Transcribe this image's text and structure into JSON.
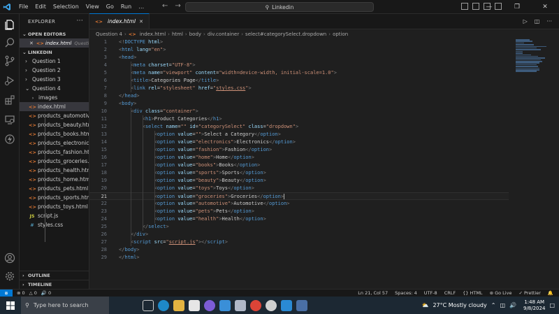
{
  "titlebar": {
    "menu": [
      "File",
      "Edit",
      "Selection",
      "View",
      "Go",
      "Run",
      "…"
    ],
    "search_text": "Linkedin"
  },
  "sidebar": {
    "title": "EXPLORER",
    "open_editors_label": "OPEN EDITORS",
    "open_editor": {
      "name": "index.html",
      "folder": "Questi..."
    },
    "workspace_label": "LINKEDIN",
    "folders": [
      "Question 1",
      "Question 2",
      "Question 3",
      "Question 4"
    ],
    "q4_items": [
      {
        "name": "images",
        "type": "folder"
      },
      {
        "name": "index.html",
        "type": "html"
      },
      {
        "name": "products_automotiv...",
        "type": "html"
      },
      {
        "name": "products_beauty.html",
        "type": "html"
      },
      {
        "name": "products_books.html",
        "type": "html"
      },
      {
        "name": "products_electronics....",
        "type": "html"
      },
      {
        "name": "products_fashion.html",
        "type": "html"
      },
      {
        "name": "products_groceries....",
        "type": "html"
      },
      {
        "name": "products_health.html",
        "type": "html"
      },
      {
        "name": "products_home.html",
        "type": "html"
      },
      {
        "name": "products_pets.html",
        "type": "html"
      },
      {
        "name": "products_sports.html",
        "type": "html"
      },
      {
        "name": "products_toys.html",
        "type": "html"
      },
      {
        "name": "script.js",
        "type": "js"
      },
      {
        "name": "styles.css",
        "type": "css"
      }
    ],
    "outline_label": "OUTLINE",
    "timeline_label": "TIMELINE"
  },
  "editor": {
    "tab_name": "index.html",
    "breadcrumb": [
      "Question 4",
      "index.html",
      "html",
      "body",
      "div.container",
      "select#categorySelect.dropdown",
      "option"
    ],
    "current_line": 21
  },
  "statusbar": {
    "errors": "0",
    "warnings": "0",
    "ports": "0",
    "position": "Ln 21, Col 57",
    "spaces": "Spaces: 4",
    "encoding": "UTF-8",
    "eol": "CRLF",
    "language": "HTML",
    "golive": "Go Live",
    "prettier": "Prettier"
  },
  "taskbar": {
    "search_placeholder": "Type here to search",
    "weather": "27°C  Mostly cloudy",
    "time": "1:48 AM",
    "date": "9/8/2024"
  }
}
